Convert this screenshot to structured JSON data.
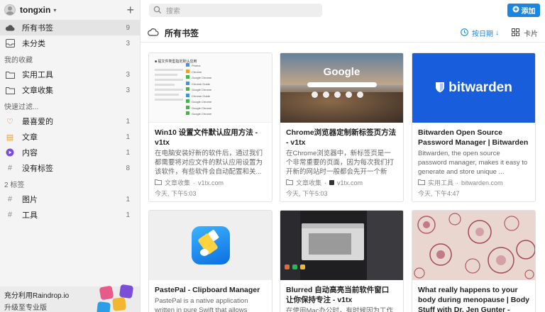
{
  "user": {
    "name": "tongxin",
    "caret": "▾",
    "plus": "+"
  },
  "sidebar": {
    "main_items": [
      {
        "label": "所有书签",
        "count": "9"
      },
      {
        "label": "未分类",
        "count": "3"
      }
    ],
    "collections_heading": "我的收藏",
    "collections": [
      {
        "label": "实用工具",
        "count": "3"
      },
      {
        "label": "文章收集",
        "count": "3"
      }
    ],
    "filters_heading": "快速过滤...",
    "filters": [
      {
        "label": "最喜爱的",
        "count": "1",
        "icon_char": "♡",
        "color": "#e0524a"
      },
      {
        "label": "文章",
        "count": "1",
        "icon_char": "▤",
        "color": "#e8a030"
      },
      {
        "label": "内容",
        "count": "1",
        "icon_char": "▶",
        "color": "#7a4fd6"
      },
      {
        "label": "没有标签",
        "count": "8",
        "icon_char": "#",
        "color": "#888888"
      }
    ],
    "tags_heading": "2 标签",
    "tags": [
      {
        "label": "图片",
        "count": "1"
      },
      {
        "label": "工具",
        "count": "1"
      }
    ],
    "promo": {
      "title": "充分利用Raindrop.io",
      "subtitle": "升级至专业版"
    }
  },
  "topbar": {
    "search_placeholder": "搜索",
    "add_label": "添加"
  },
  "header": {
    "title": "所有书签",
    "sort_label": "按日期",
    "view_label": "卡片"
  },
  "cards": [
    {
      "title": "Win10 设置文件默认应用方法 - v1tx",
      "excerpt": "在电脑安装好新的软件后，通过我们都需要将对应文件的默认应用设置为该软件，有些软件会自动配置和关...",
      "collection": "文章收集",
      "domain": "v1tx.com",
      "date": "今天, 下午5:03",
      "thumb": "win10"
    },
    {
      "title": "Chrome浏览器定制新标签页方法 - v1tx",
      "excerpt": "在Chrome浏览器中，新标签页是一个非常重要的页面，因为每次我们打开新的网站时一般都会先开一个新标...",
      "collection": "文章收集",
      "domain": "v1tx.com",
      "date": "今天, 下午5:03",
      "thumb": "google",
      "thumb_text": "Google"
    },
    {
      "title": "Bitwarden Open Source Password Manager | Bitwarden",
      "excerpt": "Bitwarden, the open source password manager, makes it easy to generate and store unique ...",
      "collection": "实用工具",
      "domain": "bitwarden.com",
      "date": "今天, 下午4:47",
      "thumb": "bitwarden",
      "thumb_text": "bitwarden"
    },
    {
      "title": "PastePal - Clipboard Manager",
      "excerpt": "PastePal is a native application written in pure Swift that allows",
      "thumb": "pastepal"
    },
    {
      "title": "Blurred 自动高亮当前软件窗口 让你保持专注 - v1tx",
      "excerpt": "在使用Mac办公时，有时候因为工作",
      "thumb": "blurred"
    },
    {
      "title": "What really happens to your body during menopause | Body Stuff with Dr. Jen Gunter -",
      "excerpt": "",
      "thumb": "cells"
    }
  ],
  "win10_thumb": {
    "heading": "■ 提文件类型指定默认应用",
    "rows": [
      "Photos",
      "Chrome",
      "Google Chrome",
      "Chrome Guide",
      "Google Chrome",
      "Chrome Guide",
      "Google Chrome",
      "Google Chrome",
      "Google Chrome"
    ]
  },
  "colors": {
    "accent": "#1a86e0",
    "bitwarden": "#175ddc"
  }
}
